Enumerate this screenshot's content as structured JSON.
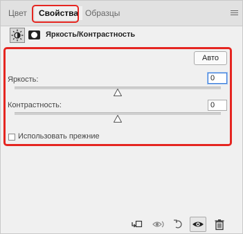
{
  "tabs": [
    {
      "label": "Цвет",
      "active": false
    },
    {
      "label": "Свойства",
      "active": true
    },
    {
      "label": "Образцы",
      "active": false
    }
  ],
  "header": {
    "title": "Яркость/Контрастность",
    "adjustment_icon": "brightness-contrast-icon",
    "mask_icon": "layer-mask-icon"
  },
  "controls": {
    "auto_label": "Авто",
    "brightness": {
      "label": "Яркость:",
      "value": "0",
      "slider_fraction": 0.5
    },
    "contrast": {
      "label": "Контрастность:",
      "value": "0",
      "slider_fraction": 0.5
    },
    "legacy": {
      "label": "Использовать прежние",
      "checked": false
    }
  },
  "toolbar": {
    "icons": [
      "clip-to-layer-icon",
      "view-previous-state-icon",
      "reset-icon",
      "visibility-eye-icon",
      "delete-icon"
    ]
  },
  "colors": {
    "highlight": "#e52520",
    "focus": "#3b7bd9"
  }
}
